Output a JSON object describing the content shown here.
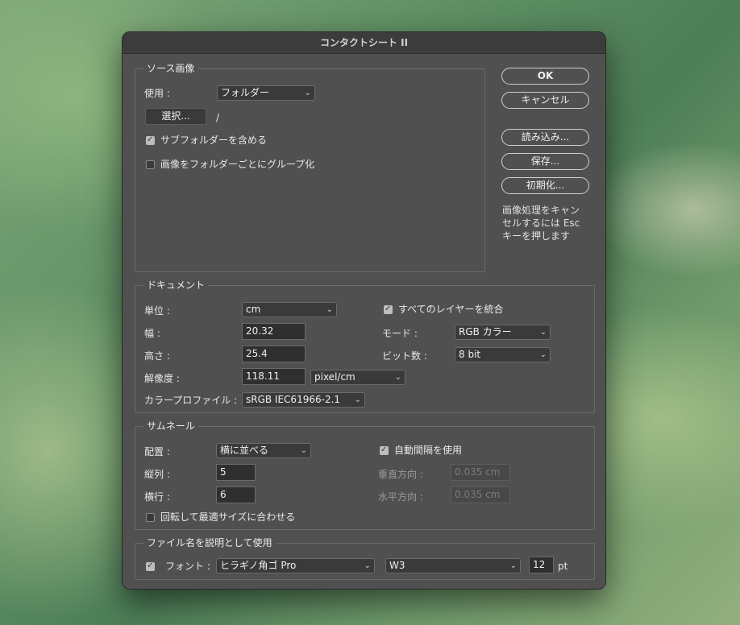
{
  "window": {
    "title": "コンタクトシート II"
  },
  "buttons": {
    "ok": "OK",
    "cancel": "キャンセル",
    "load": "読み込み...",
    "save": "保存...",
    "reset": "初期化..."
  },
  "hint": {
    "line1": "画像処理をキャン",
    "line2": "セルするには Esc",
    "line3": "キーを押します"
  },
  "source": {
    "legend": "ソース画像",
    "use_label": "使用 :",
    "use_value": "フォルダー",
    "choose_button": "選択...",
    "path": "/",
    "include_subfolders": {
      "label": "サブフォルダーを含める",
      "checked": true
    },
    "group_by_folder": {
      "label": "画像をフォルダーごとにグループ化",
      "checked": false
    }
  },
  "document": {
    "legend": "ドキュメント",
    "unit_label": "単位 :",
    "unit_value": "cm",
    "width_label": "幅 :",
    "width_value": "20.32",
    "height_label": "高さ :",
    "height_value": "25.4",
    "resolution_label": "解像度 :",
    "resolution_value": "118.11",
    "resolution_unit": "pixel/cm",
    "profile_label": "カラープロファイル :",
    "profile_value": "sRGB IEC61966-2.1",
    "flatten": {
      "label": "すべてのレイヤーを統合",
      "checked": true
    },
    "mode_label": "モード :",
    "mode_value": "RGB カラー",
    "depth_label": "ビット数 :",
    "depth_value": "8 bit"
  },
  "thumbnails": {
    "legend": "サムネール",
    "place_label": "配置 :",
    "place_value": "横に並べる",
    "columns_label": "縦列 :",
    "columns_value": "5",
    "rows_label": "横行 :",
    "rows_value": "6",
    "rotate": {
      "label": "回転して最適サイズに合わせる",
      "checked": false
    },
    "auto_spacing": {
      "label": "自動間隔を使用",
      "checked": true
    },
    "vertical_label": "垂直方向 :",
    "vertical_value": "0.035 cm",
    "horizontal_label": "水平方向 :",
    "horizontal_value": "0.035 cm"
  },
  "caption": {
    "legend": "ファイル名を説明として使用",
    "checked": true,
    "font_label": "フォント :",
    "font_value": "ヒラギノ角ゴ Pro",
    "weight_value": "W3",
    "size_value": "12",
    "size_unit": "pt"
  },
  "icons": {
    "chevron": "chevron-down-icon",
    "check": "checkmark-icon"
  }
}
